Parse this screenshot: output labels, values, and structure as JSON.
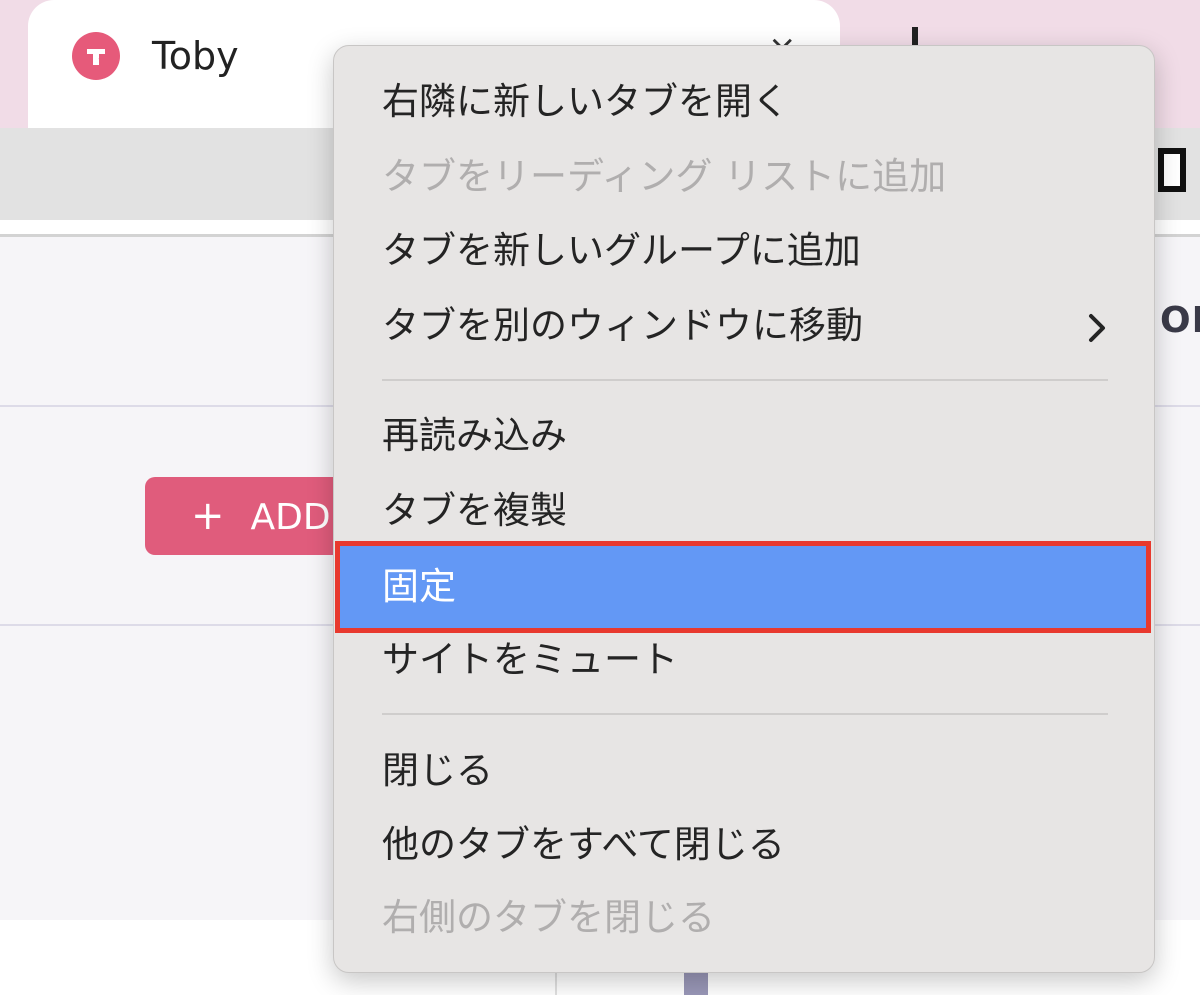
{
  "tab": {
    "title": "Toby",
    "favicon_letter": "T",
    "close_glyph": "×",
    "new_tab_glyph": "+"
  },
  "page": {
    "add_button_label": "ADD",
    "add_button_icon": "+",
    "right_column_label_fragment": "OP"
  },
  "context_menu": {
    "items": [
      {
        "label": "右隣に新しいタブを開く",
        "enabled": true
      },
      {
        "label": "タブをリーディング リストに追加",
        "enabled": false
      },
      {
        "label": "タブを新しいグループに追加",
        "enabled": true
      },
      {
        "label": "タブを別のウィンドウに移動",
        "enabled": true,
        "submenu": true
      },
      {
        "label": "再読み込み",
        "enabled": true
      },
      {
        "label": "タブを複製",
        "enabled": true
      },
      {
        "label": "固定",
        "enabled": true,
        "highlighted": true
      },
      {
        "label": "サイトをミュート",
        "enabled": true
      },
      {
        "label": "閉じる",
        "enabled": true
      },
      {
        "label": "他のタブをすべて閉じる",
        "enabled": true
      },
      {
        "label": "右側のタブを閉じる",
        "enabled": false
      }
    ]
  },
  "colors": {
    "tabstrip_bg": "#f1dce7",
    "favicon_bg": "#e65a7a",
    "add_button_bg": "#e05c7c",
    "menu_bg": "#e7e5e4",
    "highlight_bg": "#6398f5",
    "highlight_outline": "#e8392e",
    "disabled_text": "#b0aeae"
  },
  "icons": {
    "favicon": "toby-logo-icon",
    "close": "close-icon",
    "new_tab": "plus-icon",
    "submenu": "chevron-right-icon"
  }
}
